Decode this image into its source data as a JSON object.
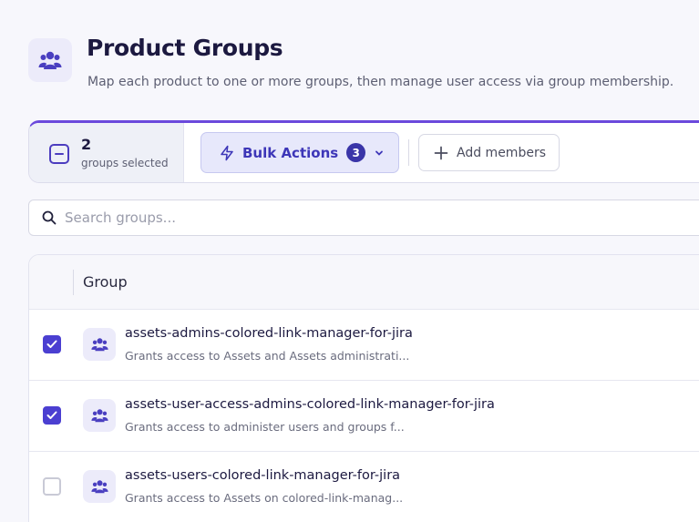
{
  "header": {
    "icon": "users-group-icon",
    "title": "Product Groups",
    "subtitle": "Map each product to one or more groups, then manage user access via group membership."
  },
  "toolbar": {
    "selected_count": "2",
    "selected_label": "groups selected",
    "bulk_actions_label": "Bulk Actions",
    "bulk_actions_count": "3",
    "add_members_label": "Add members"
  },
  "search": {
    "placeholder": "Search groups..."
  },
  "table": {
    "column_group": "Group",
    "rows": [
      {
        "name": "assets-admins-colored-link-manager-for-jira",
        "description": "Grants access to Assets and Assets administrati...",
        "checked": true
      },
      {
        "name": "assets-user-access-admins-colored-link-manager-for-jira",
        "description": "Grants access to administer users and groups f...",
        "checked": true
      },
      {
        "name": "assets-users-colored-link-manager-for-jira",
        "description": "Grants access to Assets on colored-link-manag...",
        "checked": false
      }
    ]
  },
  "colors": {
    "accent": "#4b3fd1",
    "accent_bar": "#6b49dc",
    "bulk_bg": "#e7e8fb"
  }
}
